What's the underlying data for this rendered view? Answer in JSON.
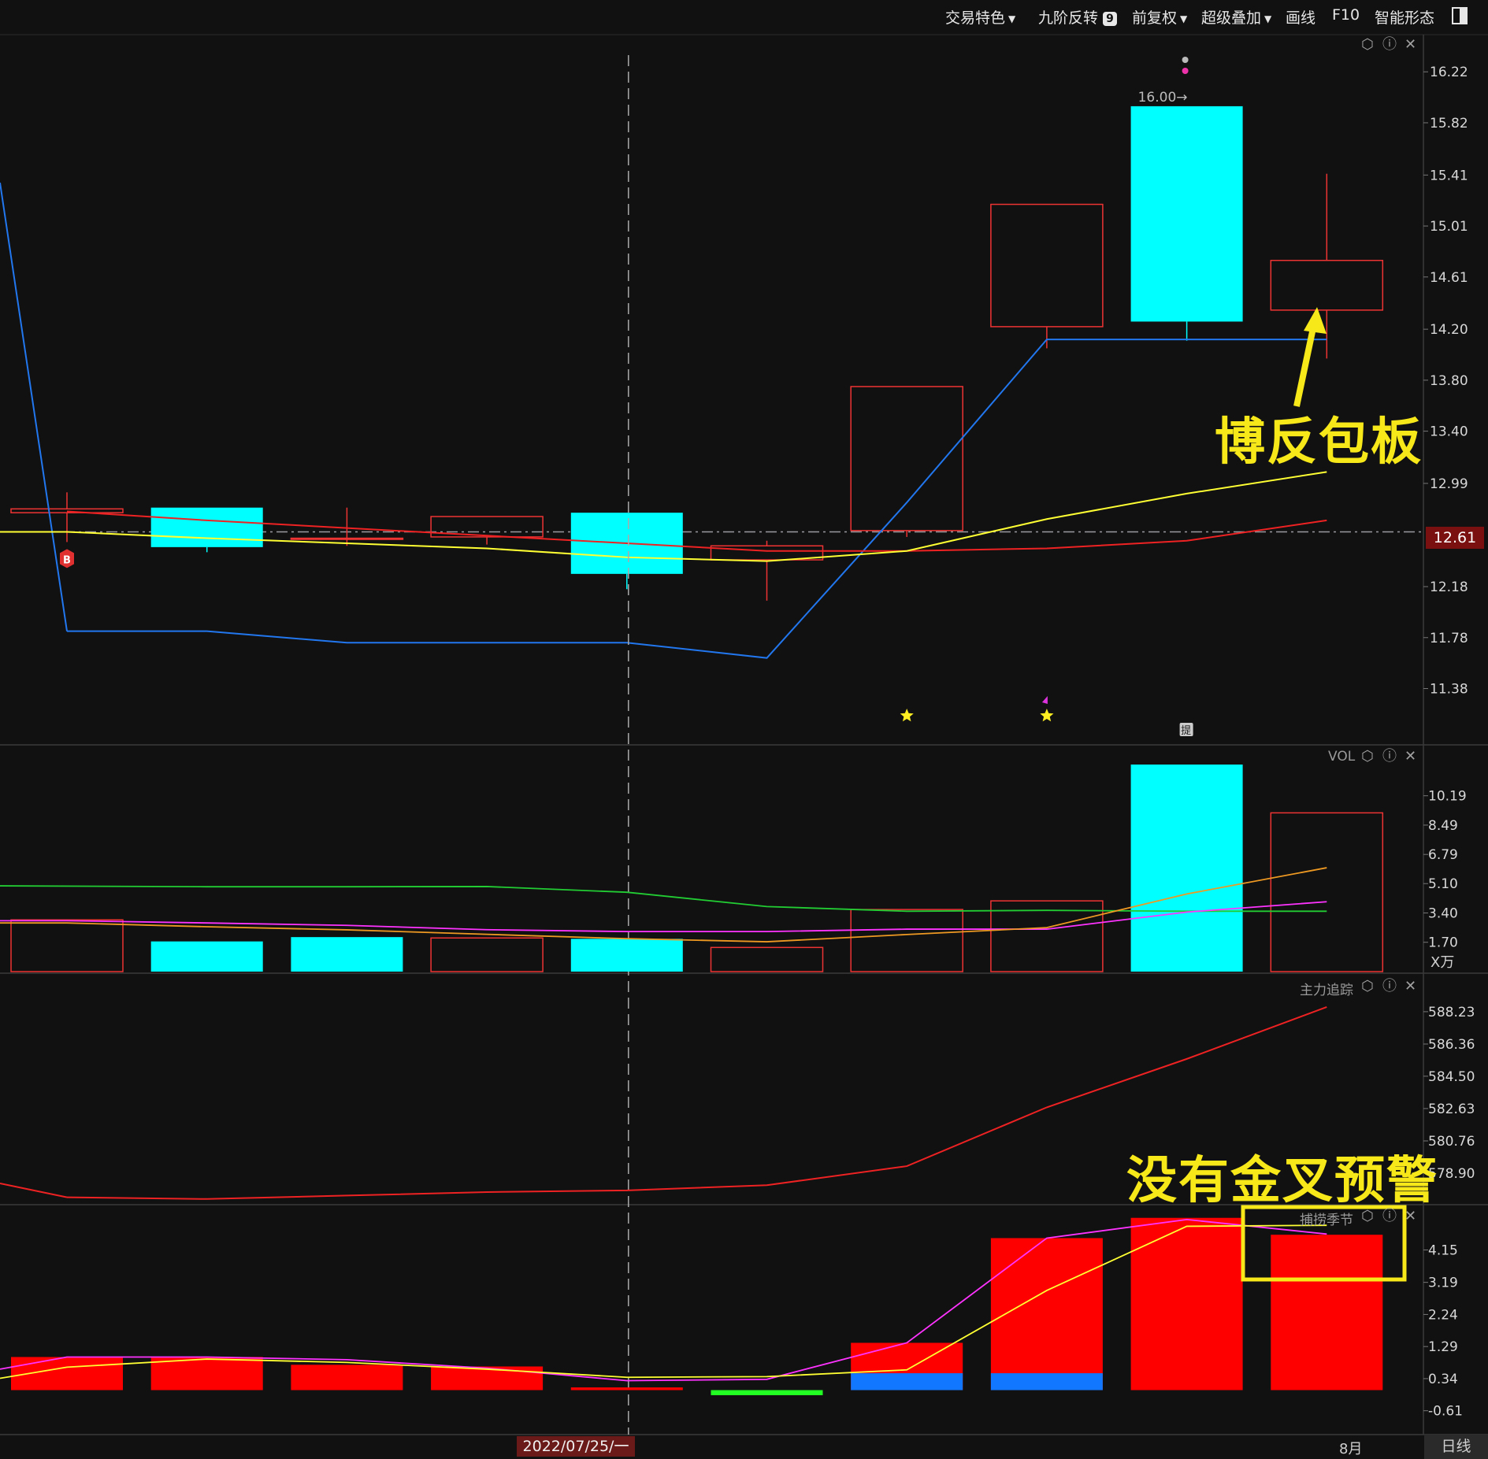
{
  "toolbar": {
    "items": [
      "交易特色",
      "九阶反转",
      "前复权",
      "超级叠加",
      "画线",
      "F10",
      "智能形态"
    ],
    "badge": "9"
  },
  "panels": {
    "vol_label": "VOL",
    "main_force_label": "主力追踪",
    "season_label": "捕捞季节",
    "vol_unit": "X万"
  },
  "annotations": {
    "bofan": "博反包板",
    "no_cross": "没有金叉预警",
    "peak_label": "16.00→",
    "buy_marker": "B",
    "ti_marker": "提"
  },
  "footer": {
    "date": "2022/07/25/一",
    "month": "8月",
    "period": "日线"
  },
  "colors": {
    "up": "#ee3333",
    "down": "#00ffff",
    "ma_yellow": "#ffff33",
    "ma_red": "#ee2222",
    "ma_blue": "#2277ee",
    "vol_green": "#22cc33",
    "vol_magenta": "#ff33ff",
    "vol_orange": "#ee9922",
    "season_red": "#ff0000",
    "season_blue": "#1177ff",
    "season_green": "#22ff22",
    "annotation": "#f7e81a"
  },
  "chart_data": [
    {
      "type": "candlestick",
      "name": "price",
      "y_ticks": [
        "16.22",
        "15.82",
        "15.41",
        "15.01",
        "14.61",
        "14.20",
        "13.80",
        "13.40",
        "12.99",
        "12.61",
        "12.18",
        "11.78",
        "11.38"
      ],
      "ylim": [
        11.0,
        16.45
      ],
      "current_price": 12.61,
      "candles": [
        {
          "open": 12.76,
          "close": 12.79,
          "high": 12.92,
          "low": 12.53
        },
        {
          "open": 12.8,
          "close": 12.49,
          "high": 12.8,
          "low": 12.45
        },
        {
          "open": 12.56,
          "close": 12.56,
          "high": 12.8,
          "low": 12.5
        },
        {
          "open": 12.57,
          "close": 12.73,
          "high": 12.73,
          "low": 12.51
        },
        {
          "open": 12.76,
          "close": 12.28,
          "high": 12.76,
          "low": 12.16
        },
        {
          "open": 12.39,
          "close": 12.5,
          "high": 12.54,
          "low": 12.07
        },
        {
          "open": 12.62,
          "close": 13.75,
          "high": 13.75,
          "low": 12.57
        },
        {
          "open": 14.22,
          "close": 15.18,
          "high": 15.18,
          "low": 14.05
        },
        {
          "open": 15.95,
          "close": 14.26,
          "high": 15.95,
          "low": 14.11
        },
        {
          "open": 14.35,
          "close": 14.74,
          "high": 15.42,
          "low": 13.97
        }
      ],
      "series": [
        {
          "name": "",
          "color": "#ffff33",
          "values": [
            12.61,
            12.56,
            12.52,
            12.48,
            12.41,
            12.38,
            12.46,
            12.71,
            12.91,
            13.08
          ]
        },
        {
          "name": "",
          "color": "#ee2222",
          "values": [
            12.77,
            12.7,
            12.64,
            12.58,
            12.52,
            12.46,
            12.46,
            12.48,
            12.54,
            12.7
          ]
        },
        {
          "name": "",
          "color": "#2277ee",
          "values": [
            11.83,
            11.83,
            11.74,
            11.74,
            11.74,
            11.62,
            12.84,
            14.12,
            14.12,
            14.12
          ]
        }
      ]
    },
    {
      "type": "bar",
      "name": "VOL",
      "y_ticks": [
        "10.19",
        "8.49",
        "6.79",
        "5.10",
        "3.40",
        "1.70"
      ],
      "ylim": [
        0,
        12.0
      ],
      "values": [
        3.0,
        1.75,
        2.0,
        1.95,
        1.9,
        1.4,
        3.6,
        4.1,
        12.0,
        9.2
      ],
      "directions": [
        "up",
        "down",
        "down",
        "up",
        "down",
        "up",
        "up",
        "up",
        "down",
        "up"
      ],
      "series": [
        {
          "name": "",
          "color": "#22cc33",
          "values": [
            4.97,
            4.92,
            4.92,
            4.93,
            4.6,
            3.77,
            3.5,
            3.55,
            3.5,
            3.5
          ]
        },
        {
          "name": "",
          "color": "#ff33ff",
          "values": [
            2.95,
            2.82,
            2.68,
            2.43,
            2.32,
            2.32,
            2.46,
            2.46,
            3.45,
            4.05
          ]
        },
        {
          "name": "",
          "color": "#ee9922",
          "values": [
            2.82,
            2.6,
            2.42,
            2.16,
            1.91,
            1.73,
            2.15,
            2.55,
            4.5,
            6.02
          ]
        }
      ]
    },
    {
      "type": "line",
      "name": "主力追踪",
      "y_ticks": [
        "588.23",
        "586.36",
        "584.50",
        "582.63",
        "580.76",
        "578.90"
      ],
      "ylim": [
        577.3,
        589.5
      ],
      "series": [
        {
          "name": "",
          "color": "#ee2222",
          "values": [
            577.5,
            577.4,
            577.6,
            577.8,
            577.9,
            578.2,
            579.3,
            582.7,
            585.5,
            588.5
          ]
        }
      ]
    },
    {
      "type": "bar",
      "name": "捕捞季节",
      "y_ticks": [
        "4.15",
        "3.19",
        "2.24",
        "1.29",
        "0.34",
        "-0.61"
      ],
      "ylim": [
        -1.2,
        5.35
      ],
      "values": [
        0.98,
        0.98,
        0.75,
        0.7,
        0.08,
        -0.15,
        1.4,
        4.5,
        5.1,
        4.6
      ],
      "blue_overlay": [
        0,
        0,
        0,
        0,
        0,
        0,
        0.5,
        0.5,
        0,
        0
      ],
      "green_overlay": [
        0,
        0,
        0,
        0,
        0,
        -0.15,
        0,
        0,
        0,
        0
      ],
      "series": [
        {
          "name": "",
          "color": "#ff33ff",
          "values": [
            0.62,
            0.98,
            0.98,
            0.9,
            0.65,
            0.28,
            0.32,
            1.4,
            4.5,
            5.05,
            4.62
          ]
        },
        {
          "name": "",
          "color": "#ffff33",
          "values": [
            0.35,
            0.68,
            0.92,
            0.82,
            0.62,
            0.38,
            0.4,
            0.6,
            2.95,
            4.85,
            4.88
          ]
        }
      ]
    }
  ]
}
